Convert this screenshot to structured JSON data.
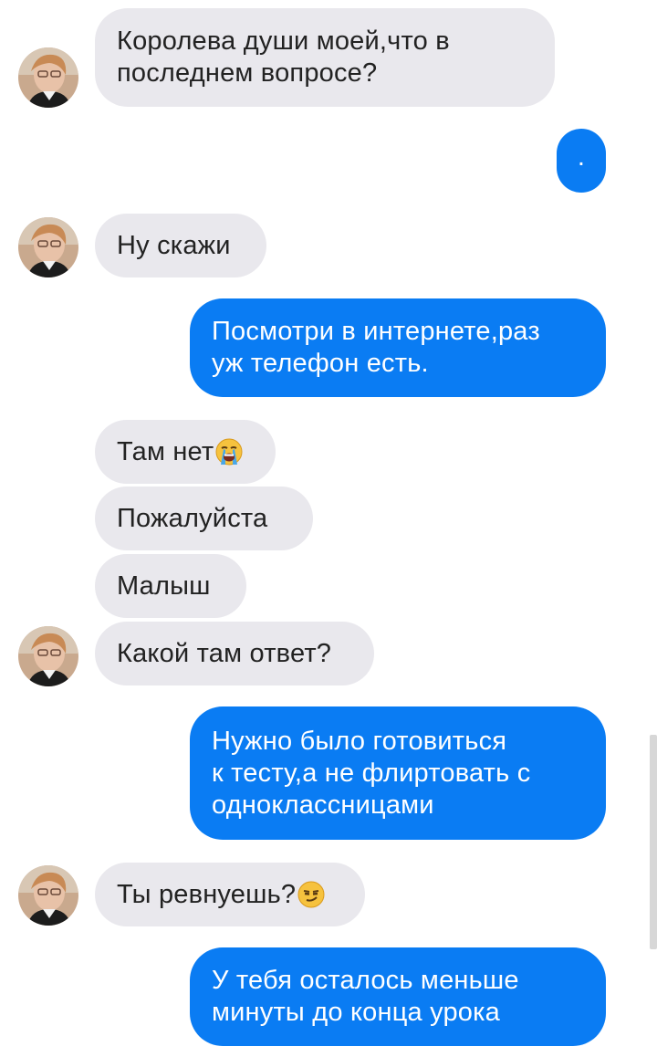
{
  "colors": {
    "incoming_bubble": "#e9e8ed",
    "outgoing_bubble": "#0a7cf3",
    "incoming_text": "#222222",
    "outgoing_text": "#ffffff"
  },
  "messages": [
    {
      "direction": "incoming",
      "lines": [
        "Королева души моей,что в",
        "последнем  вопросе?"
      ],
      "avatar": true
    },
    {
      "direction": "outgoing",
      "text": "."
    },
    {
      "direction": "incoming",
      "text": "Ну скажи",
      "avatar": true
    },
    {
      "direction": "outgoing",
      "lines": [
        "Посмотри в интернете,раз",
        "уж телефон есть."
      ]
    },
    {
      "direction": "incoming",
      "text": "Там нет",
      "emoji": "loudly-crying-face"
    },
    {
      "direction": "incoming",
      "text": "Пожалуйста"
    },
    {
      "direction": "incoming",
      "text": "Малыш"
    },
    {
      "direction": "incoming",
      "text": "Какой там ответ?",
      "avatar": true
    },
    {
      "direction": "outgoing",
      "lines": [
        "Нужно было готовиться",
        "к тесту,а не флиртовать с",
        "одноклассницами"
      ]
    },
    {
      "direction": "incoming",
      "text": "Ты ревнуешь?",
      "emoji": "smirking-face",
      "avatar": true
    },
    {
      "direction": "outgoing",
      "lines": [
        "У тебя осталось меньше",
        "минуты до конца урока"
      ]
    }
  ]
}
